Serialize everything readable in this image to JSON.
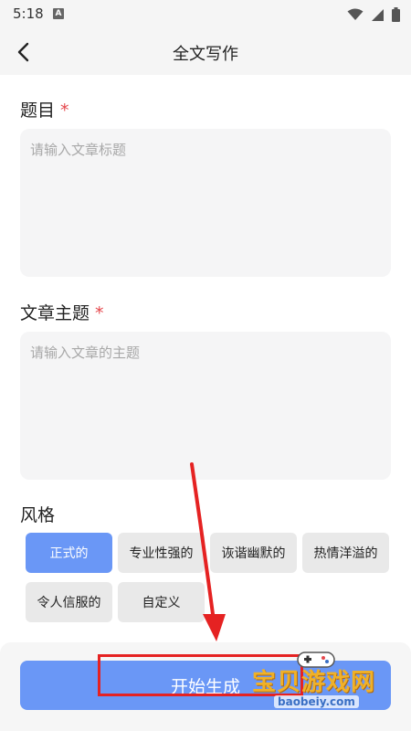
{
  "status_bar": {
    "time": "5:18",
    "badge": "A"
  },
  "header": {
    "title": "全文写作"
  },
  "title_field": {
    "label": "题目",
    "required_mark": "*",
    "placeholder": "请输入文章标题"
  },
  "theme_field": {
    "label": "文章主题",
    "required_mark": "*",
    "placeholder": "请输入文章的主题"
  },
  "style_section": {
    "label": "风格",
    "selected": "正式的",
    "options": [
      "正式的",
      "专业性强的",
      "诙谐幽默的",
      "热情洋溢的",
      "令人信服的",
      "自定义"
    ]
  },
  "actions": {
    "generate_label": "开始生成"
  },
  "watermark": {
    "name": "宝贝游戏网",
    "url": "baobeiy.com"
  },
  "colors": {
    "accent": "#6a97f6",
    "required": "#e5484d",
    "annotation": "#e52222",
    "field_bg": "#f5f5f6",
    "chip_bg": "#e9e9e9"
  },
  "icons": {
    "back": "chevron-left-icon",
    "wifi": "wifi-icon",
    "signal": "cell-signal-icon",
    "battery": "battery-icon"
  }
}
